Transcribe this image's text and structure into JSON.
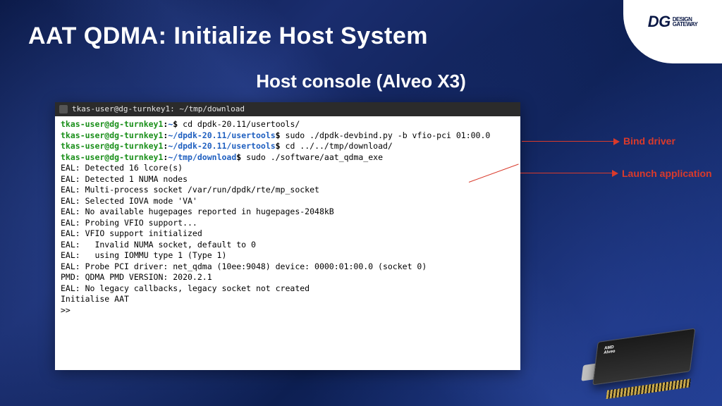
{
  "title": "AAT QDMA: Initialize Host System",
  "subtitle": "Host console (Alveo X3)",
  "logo": {
    "mark": "DG",
    "text": "DESIGN\nGATEWAY"
  },
  "terminal": {
    "window_title": "tkas-user@dg-turnkey1: ~/tmp/download",
    "lines": [
      {
        "user": "tkas-user@dg-turnkey1",
        "path": "~",
        "cmd": "cd dpdk-20.11/usertools/"
      },
      {
        "user": "tkas-user@dg-turnkey1",
        "path": "~/dpdk-20.11/usertools",
        "cmd": "sudo ./dpdk-devbind.py -b vfio-pci 01:00.0"
      },
      {
        "user": "tkas-user@dg-turnkey1",
        "path": "~/dpdk-20.11/usertools",
        "cmd": "cd ../../tmp/download/"
      },
      {
        "user": "tkas-user@dg-turnkey1",
        "path": "~/tmp/download",
        "cmd": "sudo ./software/aat_qdma_exe"
      }
    ],
    "output": [
      "EAL: Detected 16 lcore(s)",
      "EAL: Detected 1 NUMA nodes",
      "EAL: Multi-process socket /var/run/dpdk/rte/mp_socket",
      "EAL: Selected IOVA mode 'VA'",
      "EAL: No available hugepages reported in hugepages-2048kB",
      "EAL: Probing VFIO support...",
      "EAL: VFIO support initialized",
      "EAL:   Invalid NUMA socket, default to 0",
      "EAL:   using IOMMU type 1 (Type 1)",
      "EAL: Probe PCI driver: net_qdma (10ee:9048) device: 0000:01:00.0 (socket 0)",
      "PMD: QDMA PMD VERSION: 2020.2.1",
      "EAL: No legacy callbacks, legacy socket not created",
      "Initialise AAT",
      ">>"
    ]
  },
  "annotations": {
    "bind_driver": "Bind driver",
    "launch_app": "Launch application"
  },
  "card_label": "AMD\nAlveo"
}
